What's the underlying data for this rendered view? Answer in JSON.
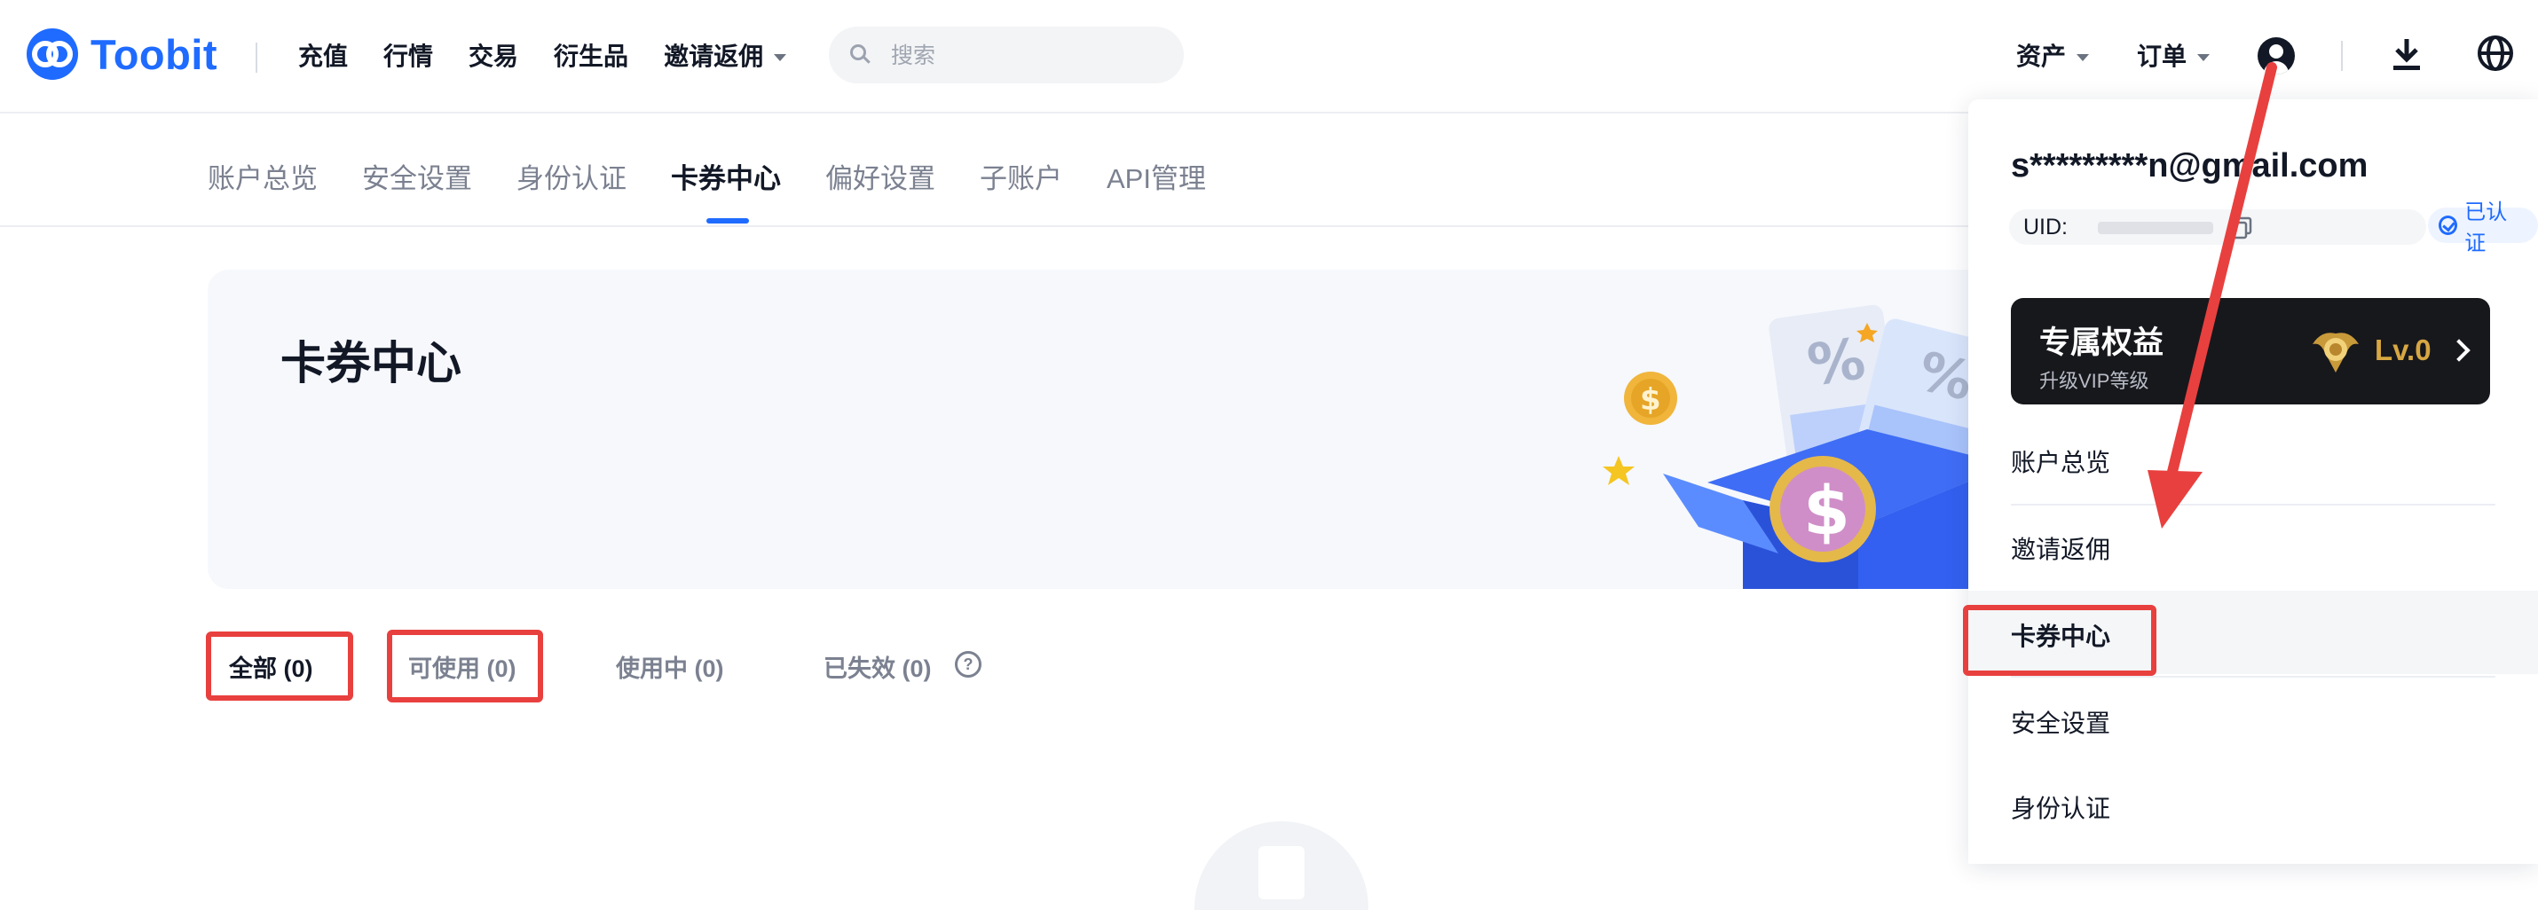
{
  "header": {
    "logo_text": "Toobit",
    "nav": [
      {
        "label": "充值"
      },
      {
        "label": "行情"
      },
      {
        "label": "交易"
      },
      {
        "label": "衍生品"
      },
      {
        "label": "邀请返佣"
      }
    ],
    "search_placeholder": "搜索",
    "right_nav": {
      "assets": "资产",
      "orders": "订单"
    },
    "brand_color": "#1f6bff"
  },
  "subtabs": [
    {
      "label": "账户总览"
    },
    {
      "label": "安全设置"
    },
    {
      "label": "身份认证"
    },
    {
      "label": "卡券中心"
    },
    {
      "label": "偏好设置"
    },
    {
      "label": "子账户"
    },
    {
      "label": "API管理"
    }
  ],
  "active_subtab": "卡券中心",
  "banner": {
    "title": "卡券中心"
  },
  "filters": [
    {
      "label": "全部 (0)"
    },
    {
      "label": "可使用 (0)"
    },
    {
      "label": "使用中 (0)"
    },
    {
      "label": "已失效 (0)"
    }
  ],
  "dropdown": {
    "email": "s*********n@gmail.com",
    "uid_label": "UID:",
    "verified": "已认证",
    "vip": {
      "title": "专属权益",
      "subtitle": "升级VIP等级",
      "level": "Lv.0"
    },
    "items": [
      {
        "label": "账户总览"
      },
      {
        "label": "邀请返佣"
      },
      {
        "label": "卡券中心"
      },
      {
        "label": "安全设置"
      },
      {
        "label": "身份认证"
      }
    ]
  },
  "annotation_color": "#e8403e"
}
